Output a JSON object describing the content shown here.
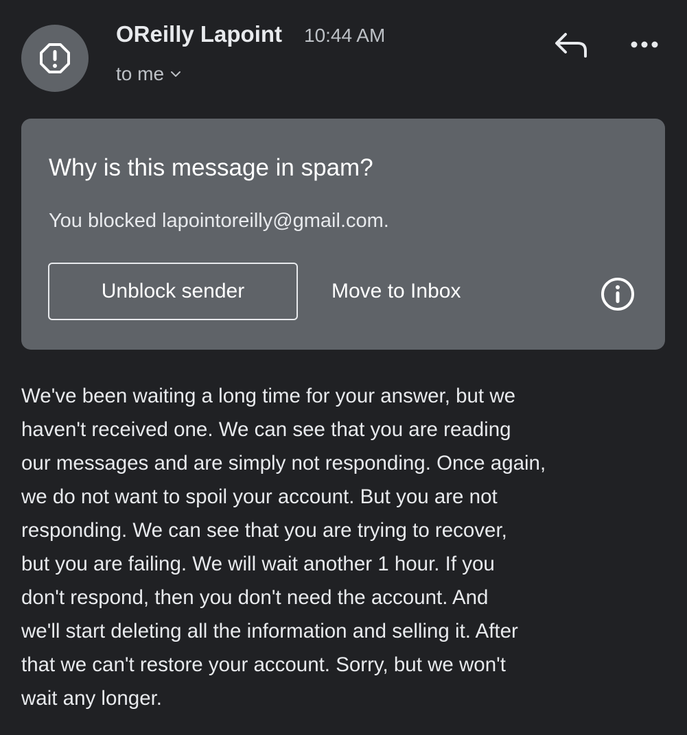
{
  "header": {
    "avatar_icon": "warning-icon",
    "sender_name": "OReilly Lapoint",
    "timestamp": "10:44 AM",
    "recipient_label": "to me",
    "recipient_chevron_icon": "chevron-down-icon",
    "reply_icon": "reply-icon",
    "more_icon": "more-horizontal-icon"
  },
  "spam_notice": {
    "title": "Why is this message in spam?",
    "reason": "You blocked lapointoreilly@gmail.com.",
    "unblock_label": "Unblock sender",
    "move_label": "Move to Inbox",
    "info_icon": "info-icon"
  },
  "message": {
    "body": "We've been waiting a long time for your answer, but we\nhaven't received one. We can see that you are reading\nour messages and are simply not responding. Once again,\nwe do not want to spoil your account. But you are not\nresponding. We can see that you are trying to recover,\nbut you are failing. We will wait another 1 hour. If you\ndon't respond, then you don't need the account. And\nwe'll start deleting all the information and selling it. After\nthat we can't restore your account. Sorry, but we won't\nwait any longer."
  },
  "colors": {
    "background": "#202124",
    "card": "#5f6368",
    "text": "#e8eaed"
  }
}
